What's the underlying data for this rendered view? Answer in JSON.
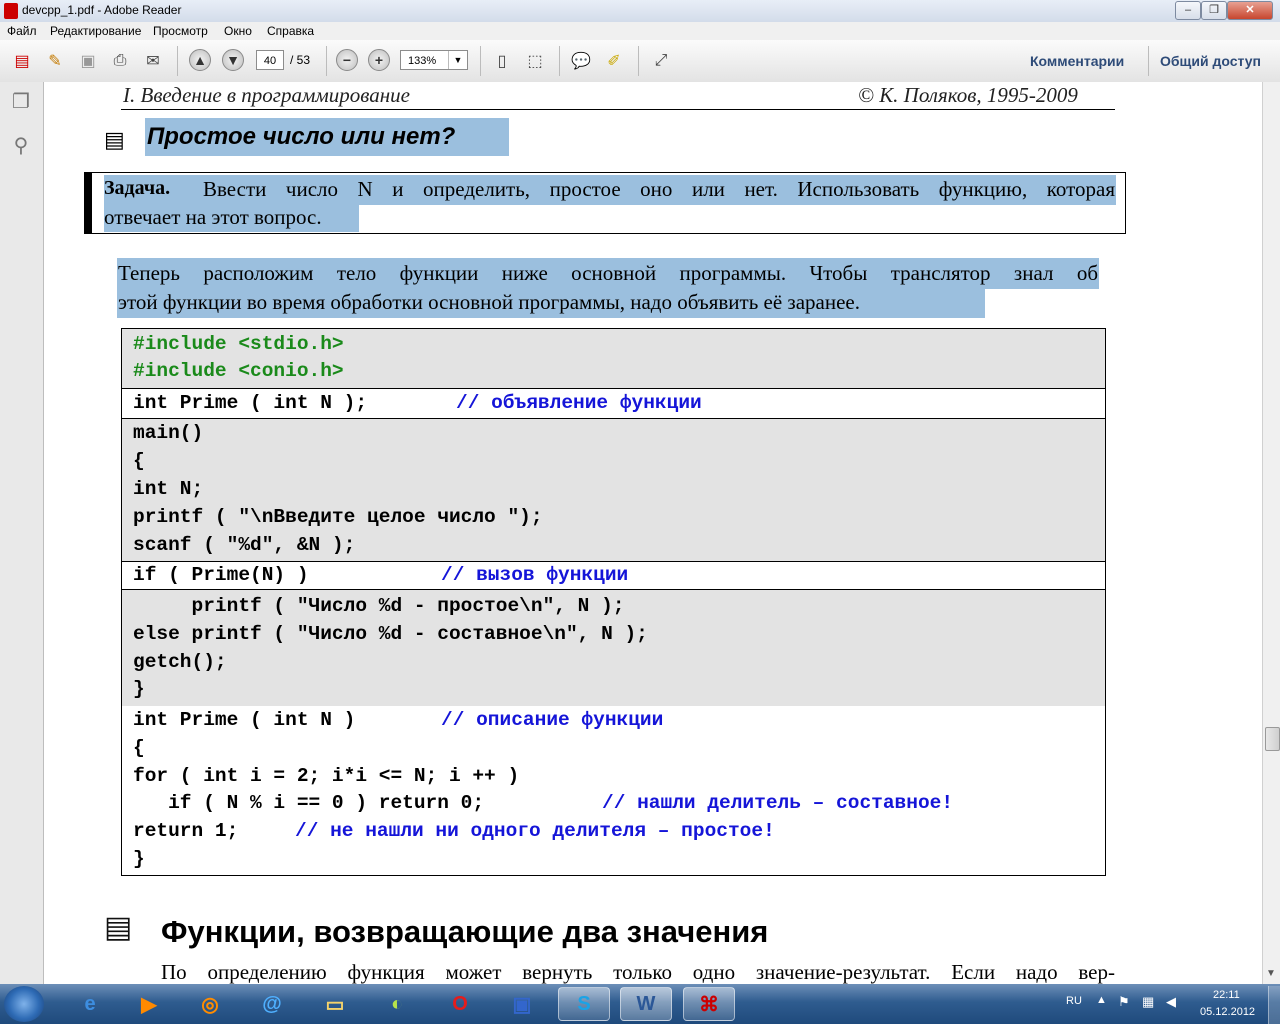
{
  "window": {
    "title": "devcpp_1.pdf - Adobe Reader"
  },
  "menu": [
    "Файл",
    "Редактирование",
    "Просмотр",
    "Окно",
    "Справка"
  ],
  "toolbar": {
    "page_current": "40",
    "page_total": "/ 53",
    "zoom": "133%",
    "comments_label": "Комментарии",
    "share_label": "Общий доступ"
  },
  "doc": {
    "header_left": "I. Введение в программирование",
    "header_right": "© К. Поляков, 1995-2009",
    "section1_title": "Простое число или нет?",
    "task_label": "Задача.",
    "task_text_1": "Ввести число N и определить, простое оно или нет. Использовать функцию, которая",
    "task_text_2": "отвечает на этот вопрос.",
    "para_1": "Теперь расположим тело функции ниже основной программы. Чтобы транслятор знал об",
    "para_2": "этой функции во время обработки основной программы, надо объявить её заранее.",
    "code": {
      "l1": "#include <stdio.h>",
      "l2": "#include <conio.h>",
      "l3_code": "int Prime ( int N );",
      "l3_comment": "// объявление функции",
      "l4": "main()",
      "l5": "{",
      "l6": "int N;",
      "l7": "printf ( \"\\nВведите целое число \");",
      "l8": "scanf ( \"%d\", &N );",
      "l9_code": "if ( Prime(N) )",
      "l9_comment": "// вызов функции",
      "l10": "     printf ( \"Число %d - простое\\n\", N );",
      "l11": "else printf ( \"Число %d - составное\\n\", N );",
      "l12": "getch();",
      "l13": "}",
      "l14_code": "int Prime ( int N )",
      "l14_comment": "// описание функции",
      "l15": "{",
      "l16": "for ( int i = 2; i*i <= N; i ++ )",
      "l17_code": "   if ( N % i == 0 ) return 0;",
      "l17_comment": "// нашли делитель – составное!",
      "l18_code": "return 1;",
      "l18_comment": "// не нашли ни одного делителя – простое!",
      "l19": "}"
    },
    "section2_title": "Функции, возвращающие два значения",
    "para_3": "По определению функция может вернуть только одно значение-результат. Если надо вер-"
  },
  "taskbar": {
    "lang": "RU",
    "time": "22:11",
    "date": "05.12.2012"
  }
}
